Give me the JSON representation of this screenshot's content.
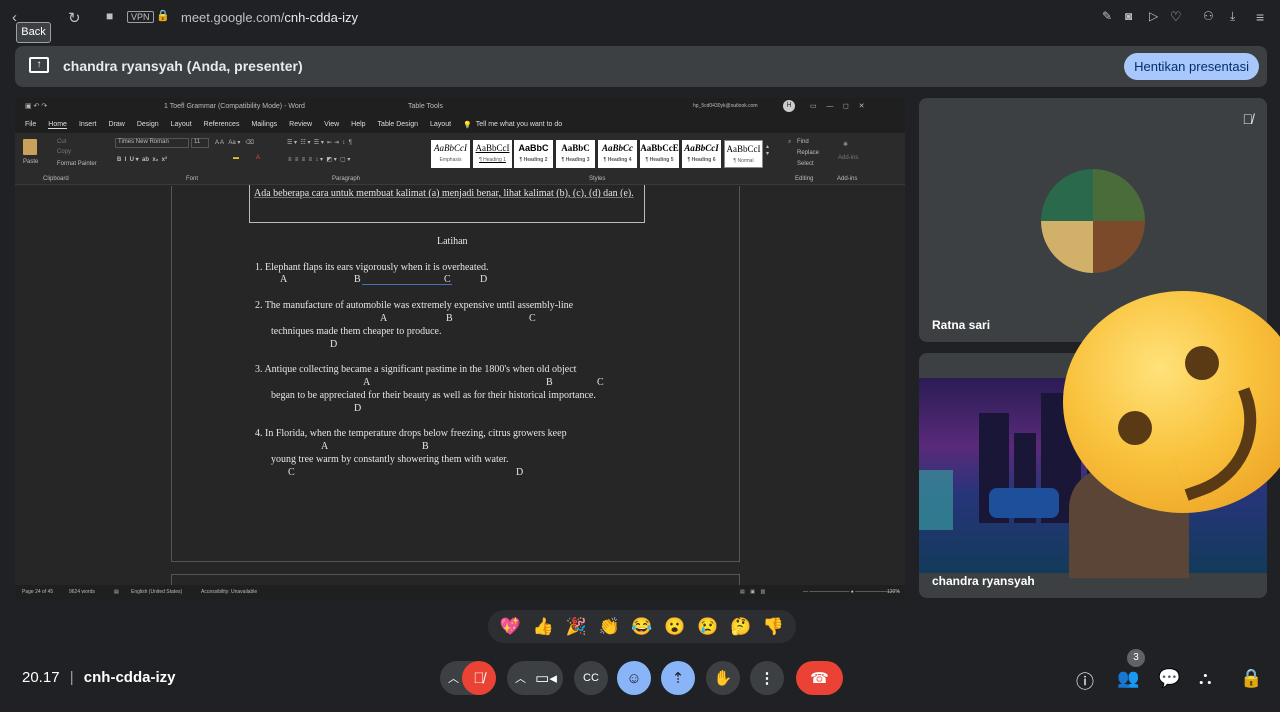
{
  "browser": {
    "url_prefix": "meet.google.com/",
    "url_path": "cnh-cdda-izy",
    "vpn_label": "VPN",
    "back_tooltip": "Back"
  },
  "presenting": {
    "text": "chandra ryansyah (Anda, presenter)",
    "stop_label": "Hentikan presentasi"
  },
  "word": {
    "title": "1 Toefl Grammar (Compatibility Mode)  -  Word",
    "table_tools": "Table Tools",
    "account": "hp_5cd0430yk@outlook.com",
    "tabs": [
      "File",
      "Home",
      "Insert",
      "Draw",
      "Design",
      "Layout",
      "References",
      "Mailings",
      "Review",
      "View",
      "Help",
      "Table Design",
      "Layout"
    ],
    "tell_me": "Tell me what you want to do",
    "clipboard": {
      "paste": "Paste",
      "cut": "Cut",
      "copy": "Copy",
      "format_painter": "Format Painter",
      "group": "Clipboard"
    },
    "font": {
      "name": "Times New Roman",
      "size": "11",
      "group": "Font"
    },
    "paragraph_group": "Paragraph",
    "styles_group": "Styles",
    "styles": [
      {
        "sample": "AaBbCcI",
        "name": "Emphasis"
      },
      {
        "sample": "AaBbCcI",
        "name": "¶ Heading 1"
      },
      {
        "sample": "AaBbC",
        "name": "¶ Heading 2"
      },
      {
        "sample": "AaBbC",
        "name": "¶ Heading 3"
      },
      {
        "sample": "AaBbCc",
        "name": "¶ Heading 4"
      },
      {
        "sample": "AaBbCcE",
        "name": "¶ Heading 5"
      },
      {
        "sample": "AaBbCcI",
        "name": "¶ Heading 6"
      },
      {
        "sample": "AaBbCcI",
        "name": "¶ Normal"
      }
    ],
    "editing": {
      "find": "Find",
      "replace": "Replace",
      "select": "Select",
      "group": "Editing"
    },
    "addins": {
      "label": "Add-ins",
      "group": "Add-ins"
    },
    "doc": {
      "intro": "Ada beberapa cara untuk membuat kalimat (a) menjadi benar, lihat kalimat (b), (c), (d) dan (e).",
      "heading": "Latihan",
      "q1": "1. Elephant flaps its ears vigorously when it is overheated.",
      "q1_letters": [
        "A",
        "B",
        "C",
        "D"
      ],
      "q2a": "2. The manufacture of automobile was extremely expensive until assembly-line",
      "q2_letters": [
        "A",
        "B",
        "C",
        "D"
      ],
      "q2b": "techniques made them cheaper to produce.",
      "q3a": "3. Antique collecting became a significant pastime in the 1800's when old object",
      "q3_letters": [
        "A",
        "B",
        "C",
        "D"
      ],
      "q3b": "began to be appreciated for their beauty as well as for their historical importance.",
      "q4a": "4. In Florida, when the temperature drops below freezing, citrus growers keep",
      "q4_letters": [
        "A",
        "B",
        "C",
        "D"
      ],
      "q4b": "young tree warm by constantly showering them with water."
    },
    "status": {
      "page": "Page 24 of 45",
      "words": "9624 words",
      "lang": "English (United States)",
      "access": "Accessibility: Unavailable",
      "zoom": "120%"
    }
  },
  "participants": [
    {
      "name": "Ratna sari",
      "muted": true
    },
    {
      "name": "chandra ryansyah"
    }
  ],
  "reactions": [
    "💖",
    "👍",
    "🎉",
    "👏",
    "😂",
    "😮",
    "😢",
    "🤔",
    "👎"
  ],
  "meeting": {
    "time": "20.17",
    "code": "cnh-cdda-izy"
  },
  "people_count": "3",
  "colors": {
    "accent": "#a8c7fa",
    "end_call": "#ea4335",
    "mic_off": "#ea4335",
    "active_btn": "#8ab4f8"
  }
}
